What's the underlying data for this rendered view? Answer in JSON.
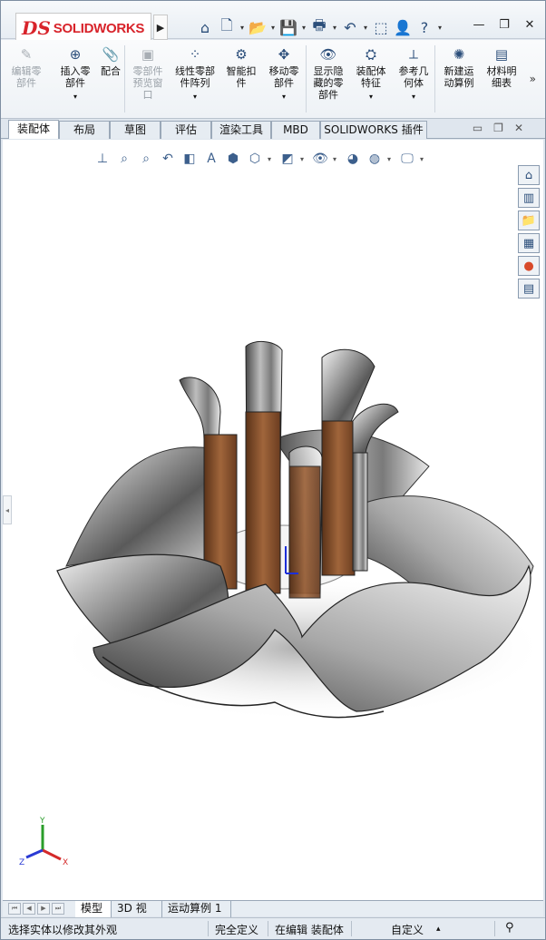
{
  "app": {
    "logo_mark": "DS",
    "logo_text": "SOLIDWORKS",
    "menu_arrow": "▶"
  },
  "quick_access": [
    {
      "icon": "home-icon",
      "glyph": "⌂"
    },
    {
      "icon": "new-document-icon",
      "glyph": "🗋"
    },
    {
      "icon": "open-folder-icon",
      "glyph": "📂"
    },
    {
      "icon": "save-icon",
      "glyph": "💾"
    },
    {
      "icon": "print-icon",
      "glyph": "🖶"
    },
    {
      "icon": "undo-icon",
      "glyph": "↶"
    },
    {
      "icon": "select-cursor-icon",
      "glyph": "⬚"
    },
    {
      "icon": "user-icon",
      "glyph": "👤"
    },
    {
      "icon": "help-icon",
      "glyph": "?"
    }
  ],
  "window_controls": {
    "minimize": "—",
    "restore": "❐",
    "close": "✕"
  },
  "ribbon": {
    "items": [
      {
        "label": "编辑零\n部件",
        "icon": "edit-component-icon",
        "glyph": "✎",
        "disabled": true
      },
      {
        "label": "插入零\n部件",
        "icon": "insert-component-icon",
        "glyph": "⊕",
        "disabled": false,
        "drop": "▾"
      },
      {
        "label": "配合",
        "icon": "mate-icon",
        "glyph": "📎",
        "disabled": false
      },
      {
        "label": "零部件\n预览窗\n口",
        "icon": "component-preview-icon",
        "glyph": "▣",
        "disabled": true
      },
      {
        "label": "线性零部\n件阵列",
        "icon": "linear-pattern-icon",
        "glyph": "⁘",
        "disabled": false,
        "drop": "▾"
      },
      {
        "label": "智能扣\n件",
        "icon": "smart-fastener-icon",
        "glyph": "⚙",
        "disabled": false
      },
      {
        "label": "移动零\n部件",
        "icon": "move-component-icon",
        "glyph": "✥",
        "disabled": false,
        "drop": "▾"
      },
      {
        "label": "显示隐\n藏的零\n部件",
        "icon": "show-hidden-icon",
        "glyph": "👁",
        "disabled": false
      },
      {
        "label": "装配体\n特征",
        "icon": "assembly-feature-icon",
        "glyph": "⛭",
        "disabled": false,
        "drop": "▾"
      },
      {
        "label": "参考几\n何体",
        "icon": "reference-geometry-icon",
        "glyph": "⟂",
        "disabled": false,
        "drop": "▾"
      },
      {
        "label": "新建运\n动算例",
        "icon": "new-motion-study-icon",
        "glyph": "✺",
        "disabled": false
      },
      {
        "label": "材料明\n细表",
        "icon": "bill-of-materials-icon",
        "glyph": "▤",
        "disabled": false
      }
    ],
    "more": "»"
  },
  "tabs": [
    {
      "label": "装配体",
      "active": true
    },
    {
      "label": "布局",
      "active": false
    },
    {
      "label": "草图",
      "active": false
    },
    {
      "label": "评估",
      "active": false
    },
    {
      "label": "渲染工具",
      "active": false
    },
    {
      "label": "MBD",
      "active": false
    },
    {
      "label": "SOLIDWORKS 插件",
      "active": false
    }
  ],
  "doc_controls": {
    "minimize": "▭",
    "restore": "❐",
    "close": "✕"
  },
  "heads_up_toolbar": [
    {
      "icon": "view-orientation-icon",
      "glyph": "⊥"
    },
    {
      "icon": "zoom-to-fit-icon",
      "glyph": "⌕"
    },
    {
      "icon": "zoom-to-area-icon",
      "glyph": "⌕"
    },
    {
      "icon": "previous-view-icon",
      "glyph": "↶"
    },
    {
      "icon": "section-view-icon",
      "glyph": "◧"
    },
    {
      "icon": "dynamic-annotation-icon",
      "glyph": "A"
    },
    {
      "icon": "view-cube-icon",
      "glyph": "⬢"
    },
    {
      "icon": "view-orientation-dropdown-icon",
      "glyph": "⬡",
      "drop": true
    },
    {
      "icon": "display-style-icon",
      "glyph": "◩",
      "drop": true
    },
    {
      "icon": "hide-show-items-icon",
      "glyph": "👁",
      "drop": true
    },
    {
      "icon": "edit-appearance-icon",
      "glyph": "◕"
    },
    {
      "icon": "apply-scene-icon",
      "glyph": "◍",
      "drop": true
    },
    {
      "icon": "view-settings-icon",
      "glyph": "🖵",
      "drop": true
    }
  ],
  "task_pane": [
    {
      "icon": "task-home-icon",
      "glyph": "⌂"
    },
    {
      "icon": "design-library-icon",
      "glyph": "▥"
    },
    {
      "icon": "file-explorer-icon",
      "glyph": "📁"
    },
    {
      "icon": "view-palette-icon",
      "glyph": "▦"
    },
    {
      "icon": "appearances-icon",
      "glyph": "●"
    },
    {
      "icon": "custom-properties-icon",
      "glyph": "▤"
    }
  ],
  "triad": {
    "x": "X",
    "y": "Y",
    "z": "Z"
  },
  "bottom_tabs": [
    {
      "label": "模型",
      "active": true
    },
    {
      "label": "3D 视图",
      "active": false
    },
    {
      "label": "运动算例 1",
      "active": false
    }
  ],
  "status": {
    "message": "选择实体以修改其外观",
    "definition": "完全定义",
    "editing": "在编辑 装配体",
    "units": "自定义",
    "units_drop": "▴"
  },
  "colors": {
    "accent": "#d8232a",
    "icon_blue": "#2b4e7a",
    "metal": "#8c8c8c",
    "wood": "#8a5a3a"
  }
}
